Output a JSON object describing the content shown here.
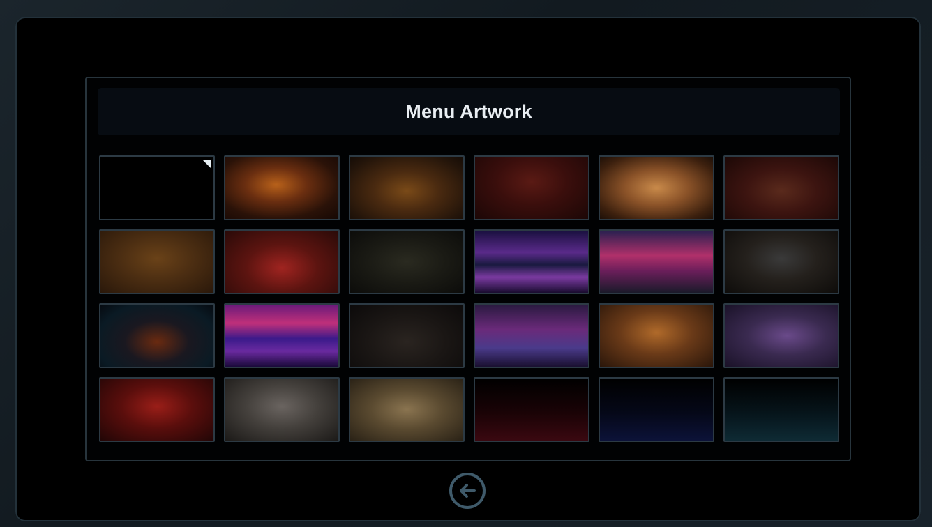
{
  "panel": {
    "title": "Menu Artwork"
  },
  "back_button": {
    "icon": "arrow-left-circle-icon"
  },
  "artwork_tiles": [
    {
      "name": "blank-black",
      "selected": true,
      "bg": "#000000"
    },
    {
      "name": "demon-reading-book",
      "bg": "radial-gradient(ellipse at 45% 45%, #b8611a 0%, #6a2e10 35%, #2a1208 70%, #160804 100%)"
    },
    {
      "name": "haunted-forest-amber",
      "bg": "radial-gradient(ellipse at 50% 55%, #7a4a18 0%, #4a2a10 40%, #24150a 80%, #150c06 100%)"
    },
    {
      "name": "vampire-at-table",
      "bg": "radial-gradient(ellipse at 50% 40%, #5a1a14 0%, #3a0e0c 45%, #1c0706 100%)"
    },
    {
      "name": "open-spellbook-candles",
      "bg": "radial-gradient(ellipse at 50% 50%, #c98a4a 0%, #8a5228 40%, #3c200e 80%, #1e1008 100%)"
    },
    {
      "name": "hooded-priest-altar",
      "bg": "radial-gradient(ellipse at 50% 55%, #5a2a1c 0%, #3c1410 45%, #1c0806 100%)"
    },
    {
      "name": "golden-ornate-wall",
      "bg": "radial-gradient(ellipse at 50% 45%, #6a4218 0%, #4c2e12 45%, #2a180a 100%)"
    },
    {
      "name": "cultist-feast",
      "bg": "radial-gradient(ellipse at 50% 60%, #a02420 0%, #5c1410 45%, #2a0a08 100%)"
    },
    {
      "name": "skeleton-creature-corridor",
      "bg": "radial-gradient(ellipse at 50% 50%, #2a2a20 0%, #1a1a14 50%, #0c0c0a 100%)"
    },
    {
      "name": "neon-spaceship-hallway",
      "bg": "linear-gradient(180deg, #1a1040 0%, #5a2a8a 35%, #1a1a40 55%, #7a3aa0 75%, #1a0c30 100%)"
    },
    {
      "name": "cyberpunk-city-street",
      "bg": "linear-gradient(180deg, #2a2050 0%, #b0306a 40%, #6a1e5a 65%, #1a1a2a 100%)"
    },
    {
      "name": "dark-stone-corridor",
      "bg": "radial-gradient(ellipse at 50% 45%, #3a3a3a 0%, #24201c 45%, #0e0c0a 100%)"
    },
    {
      "name": "neon-circuit-corridor",
      "bg": "radial-gradient(ellipse at 50% 60%, #6a2a10 0%, #1a1820 40%, #0a1a24 75%, #060a10 100%)"
    },
    {
      "name": "synthwave-skyline",
      "bg": "linear-gradient(180deg, #6a1a7a 0%, #c0307a 30%, #3a1a8a 55%, #6a2aa0 75%, #1a0a3a 100%)"
    },
    {
      "name": "shadow-figure-dark",
      "bg": "radial-gradient(ellipse at 50% 60%, #2a2420 0%, #1a1614 50%, #0c0a0a 100%)"
    },
    {
      "name": "purple-tech-shelves",
      "bg": "linear-gradient(180deg, #2a1a40 0%, #6a2a7a 40%, #4a3a8a 70%, #1a1030 100%)"
    },
    {
      "name": "steampunk-control-room",
      "bg": "radial-gradient(ellipse at 50% 45%, #b06a2a 0%, #6a3a18 45%, #2a160a 100%)"
    },
    {
      "name": "purple-gothic-archway",
      "bg": "radial-gradient(ellipse at 55% 50%, #6a4a8a 0%, #3a2a50 45%, #1a1228 100%)"
    },
    {
      "name": "red-throne-altar",
      "bg": "radial-gradient(ellipse at 50% 45%, #9a1e18 0%, #5a0e0c 45%, #220606 100%)"
    },
    {
      "name": "demon-face-smoke",
      "bg": "radial-gradient(ellipse at 50% 45%, #6a6460 0%, #44403c 45%, #1c1a18 100%)"
    },
    {
      "name": "ancient-open-book",
      "bg": "radial-gradient(ellipse at 50% 50%, #8a7450 0%, #5a4a30 45%, #2a2216 100%)"
    },
    {
      "name": "red-fade-gradient",
      "bg": "linear-gradient(180deg, #000000 0%, #1a0306 55%, #3a0810 100%)"
    },
    {
      "name": "blue-fade-gradient",
      "bg": "linear-gradient(180deg, #000000 0%, #050818 55%, #0c1238 100%)"
    },
    {
      "name": "teal-fade-gradient",
      "bg": "linear-gradient(180deg, #000000 0%, #06141a 55%, #0e2a34 100%)"
    }
  ]
}
